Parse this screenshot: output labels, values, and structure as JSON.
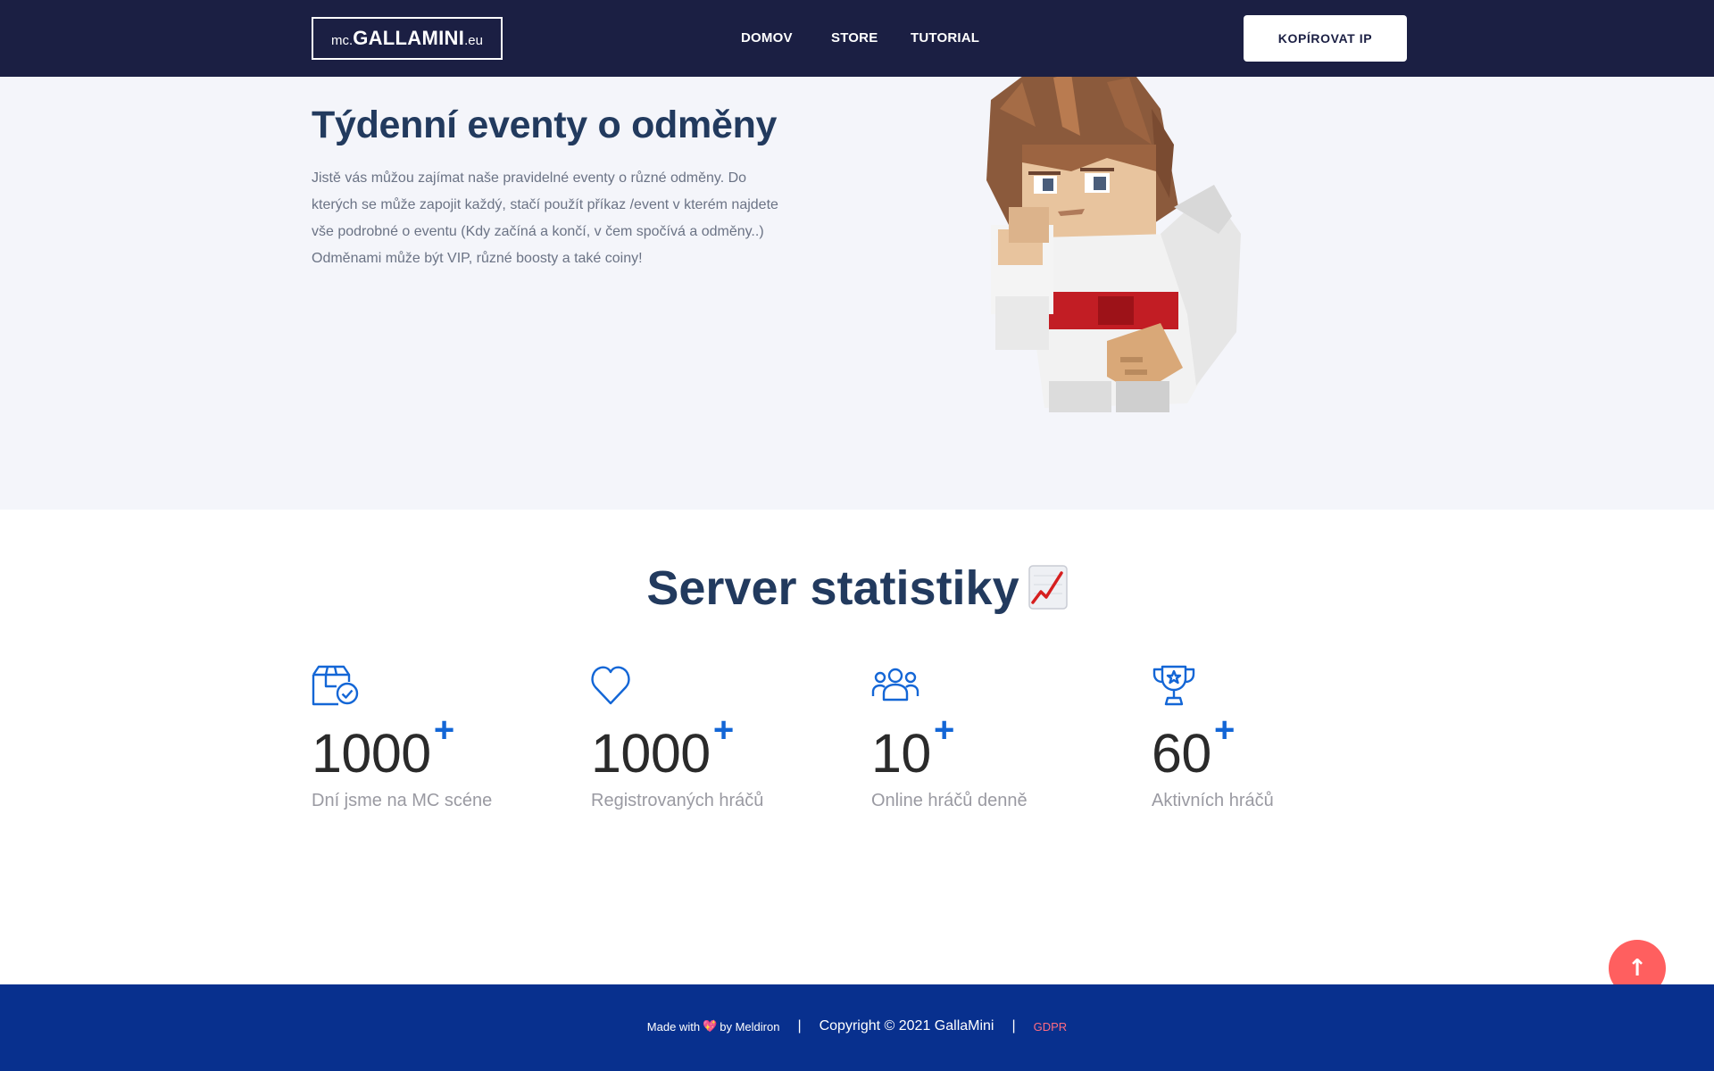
{
  "navbar": {
    "logo": {
      "prefix": "mc.",
      "name": "GALLAMINI",
      "suffix": ".eu"
    },
    "links": [
      "DOMOV",
      "STORE",
      "TUTORIAL"
    ],
    "copy_ip_label": "KOPÍROVAT IP",
    "colors": {
      "background": "#1b1f43"
    }
  },
  "events": {
    "title": "Týdenní eventy o odměny",
    "text": "Jistě vás můžou zajímat naše pravidelné eventy o různé odměny. Do kterých se může zapojit každý, stačí použít příkaz /event v kterém najdete vše podrobné o eventu (Kdy začíná a končí, v čem spočívá a odměny..) Odměnami může být VIP, různé boosty a také coiny!",
    "illustration": "minecraft-character-thinking"
  },
  "stats": {
    "title": "Server statistiky",
    "title_emoji_icon": "chart-increasing-emoji",
    "items": [
      {
        "icon": "box-check-icon",
        "value": "1000",
        "plus": "+",
        "label": "Dní jsme na MC scéne"
      },
      {
        "icon": "heart-icon",
        "value": "1000",
        "plus": "+",
        "label": "Registrovaných hráčů"
      },
      {
        "icon": "users-group-icon",
        "value": "10",
        "plus": "+",
        "label": "Online hráčů denně"
      },
      {
        "icon": "trophy-icon",
        "value": "60",
        "plus": "+",
        "label": "Aktivních hráčů"
      }
    ],
    "accent_color": "#1366d6"
  },
  "back_to_top": {
    "icon": "arrow-up-icon",
    "glyph": "↑",
    "color": "#ff5f5f"
  },
  "footer": {
    "made_with": "Made with",
    "heart": "💖",
    "by": "by Meldiron",
    "separator": "|",
    "copyright": "Copyright © 2021 GallaMini",
    "gdpr": "GDPR",
    "colors": {
      "background": "#08308e",
      "link": "#ff6b81"
    }
  }
}
